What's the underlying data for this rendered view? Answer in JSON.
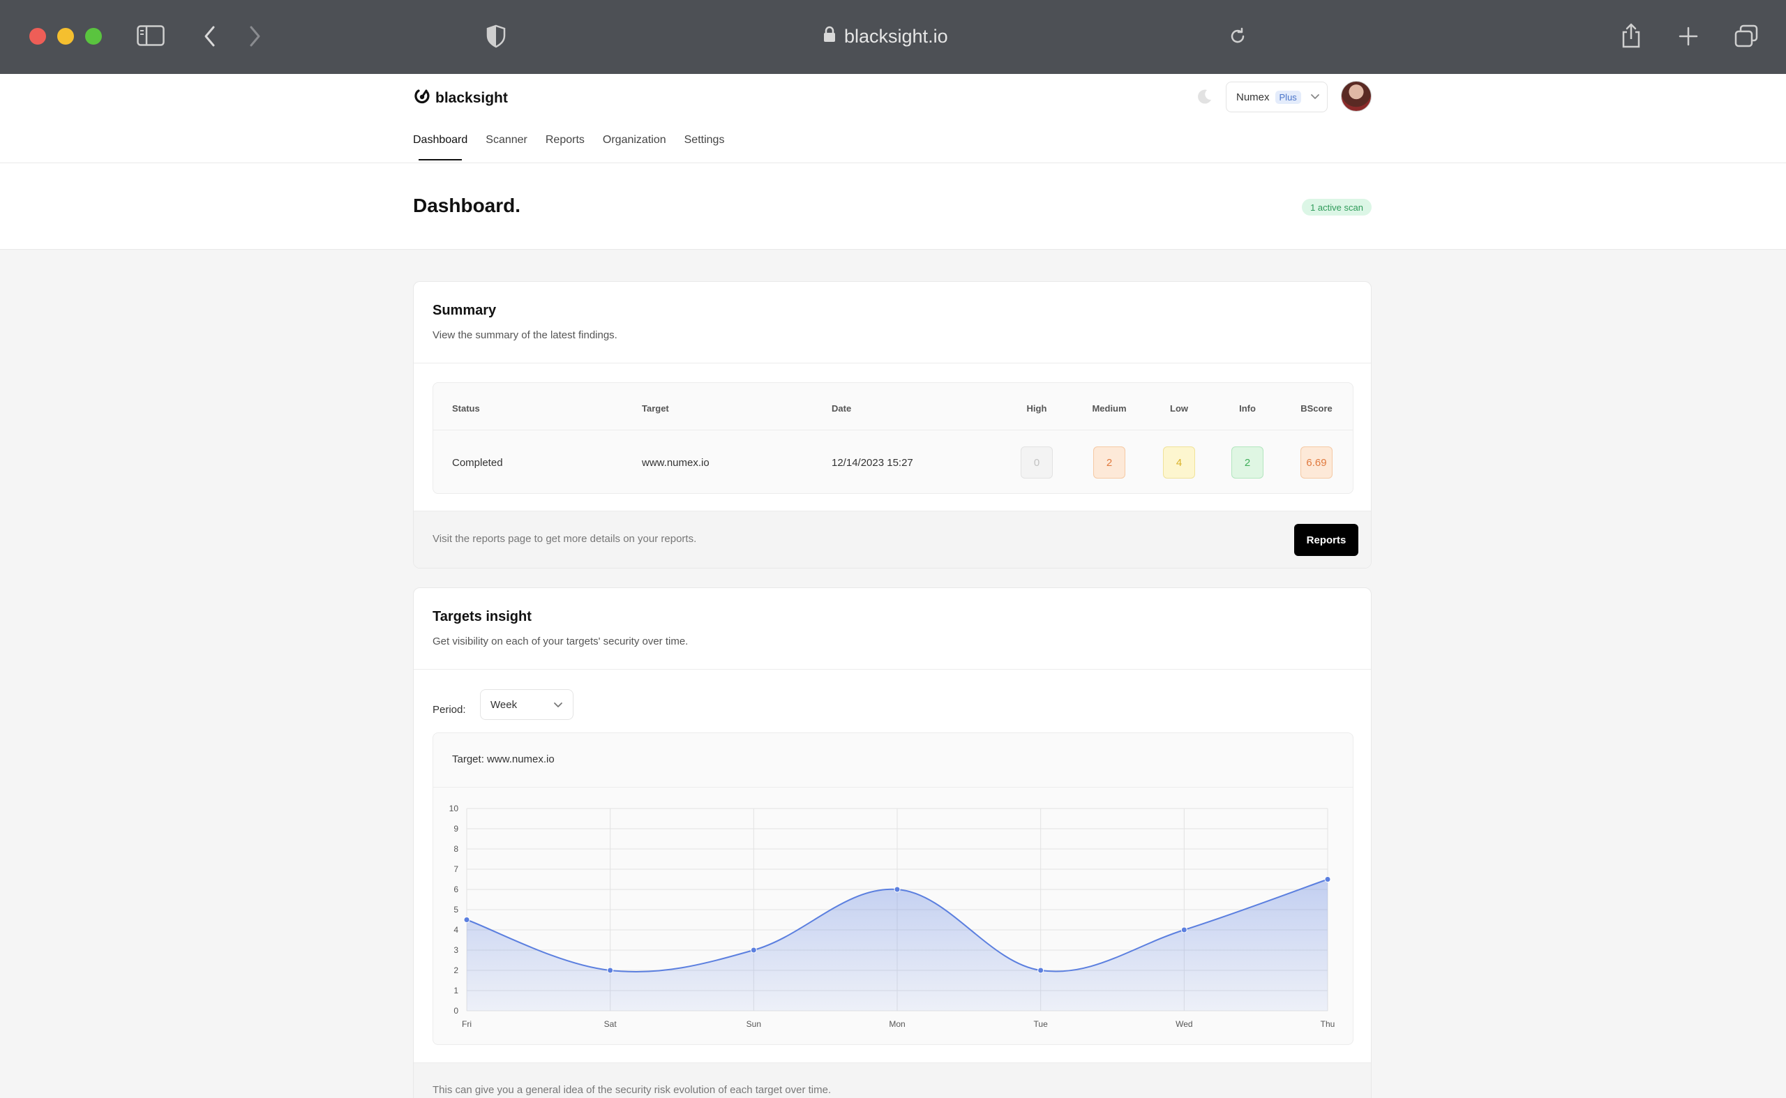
{
  "browser": {
    "url": "blacksight.io"
  },
  "app": {
    "brand": "blacksight",
    "nav": [
      "Dashboard",
      "Scanner",
      "Reports",
      "Organization",
      "Settings"
    ],
    "active_nav": "Dashboard",
    "org": {
      "name": "Numex",
      "plan": "Plus"
    }
  },
  "page": {
    "title": "Dashboard.",
    "active_scans": "1 active scan"
  },
  "summary": {
    "title": "Summary",
    "subtitle": "View the summary of the latest findings.",
    "columns": [
      "Status",
      "Target",
      "Date",
      "High",
      "Medium",
      "Low",
      "Info",
      "BScore"
    ],
    "row": {
      "status": "Completed",
      "target": "www.numex.io",
      "date": "12/14/2023 15:27",
      "high": "0",
      "medium": "2",
      "low": "4",
      "info": "2",
      "bscore": "6.69"
    },
    "footer_text": "Visit the reports page to get more details on your reports.",
    "reports_button": "Reports"
  },
  "targets": {
    "title": "Targets insight",
    "subtitle": "Get visibility on each of your targets' security over time.",
    "period_label": "Period:",
    "period_value": "Week",
    "chart_target": "Target: www.numex.io",
    "footer_text": "This can give you a general idea of the security risk evolution of each target over time."
  },
  "colors": {
    "accent": "#5b7fdf",
    "severity_high": "#bdbdbd",
    "severity_medium": "#e07a3f",
    "severity_low": "#d9b22a",
    "severity_info": "#3fae5a",
    "bscore": "#e07a3f"
  },
  "chart_data": {
    "type": "area",
    "categories": [
      "Fri",
      "Sat",
      "Sun",
      "Mon",
      "Tue",
      "Wed",
      "Thu"
    ],
    "values": [
      4.5,
      2,
      3,
      6,
      2,
      4,
      6.5
    ],
    "yticks": [
      0,
      1,
      2,
      3,
      4,
      5,
      6,
      7,
      8,
      9,
      10
    ],
    "ylim": [
      0,
      10
    ],
    "grid": true
  }
}
